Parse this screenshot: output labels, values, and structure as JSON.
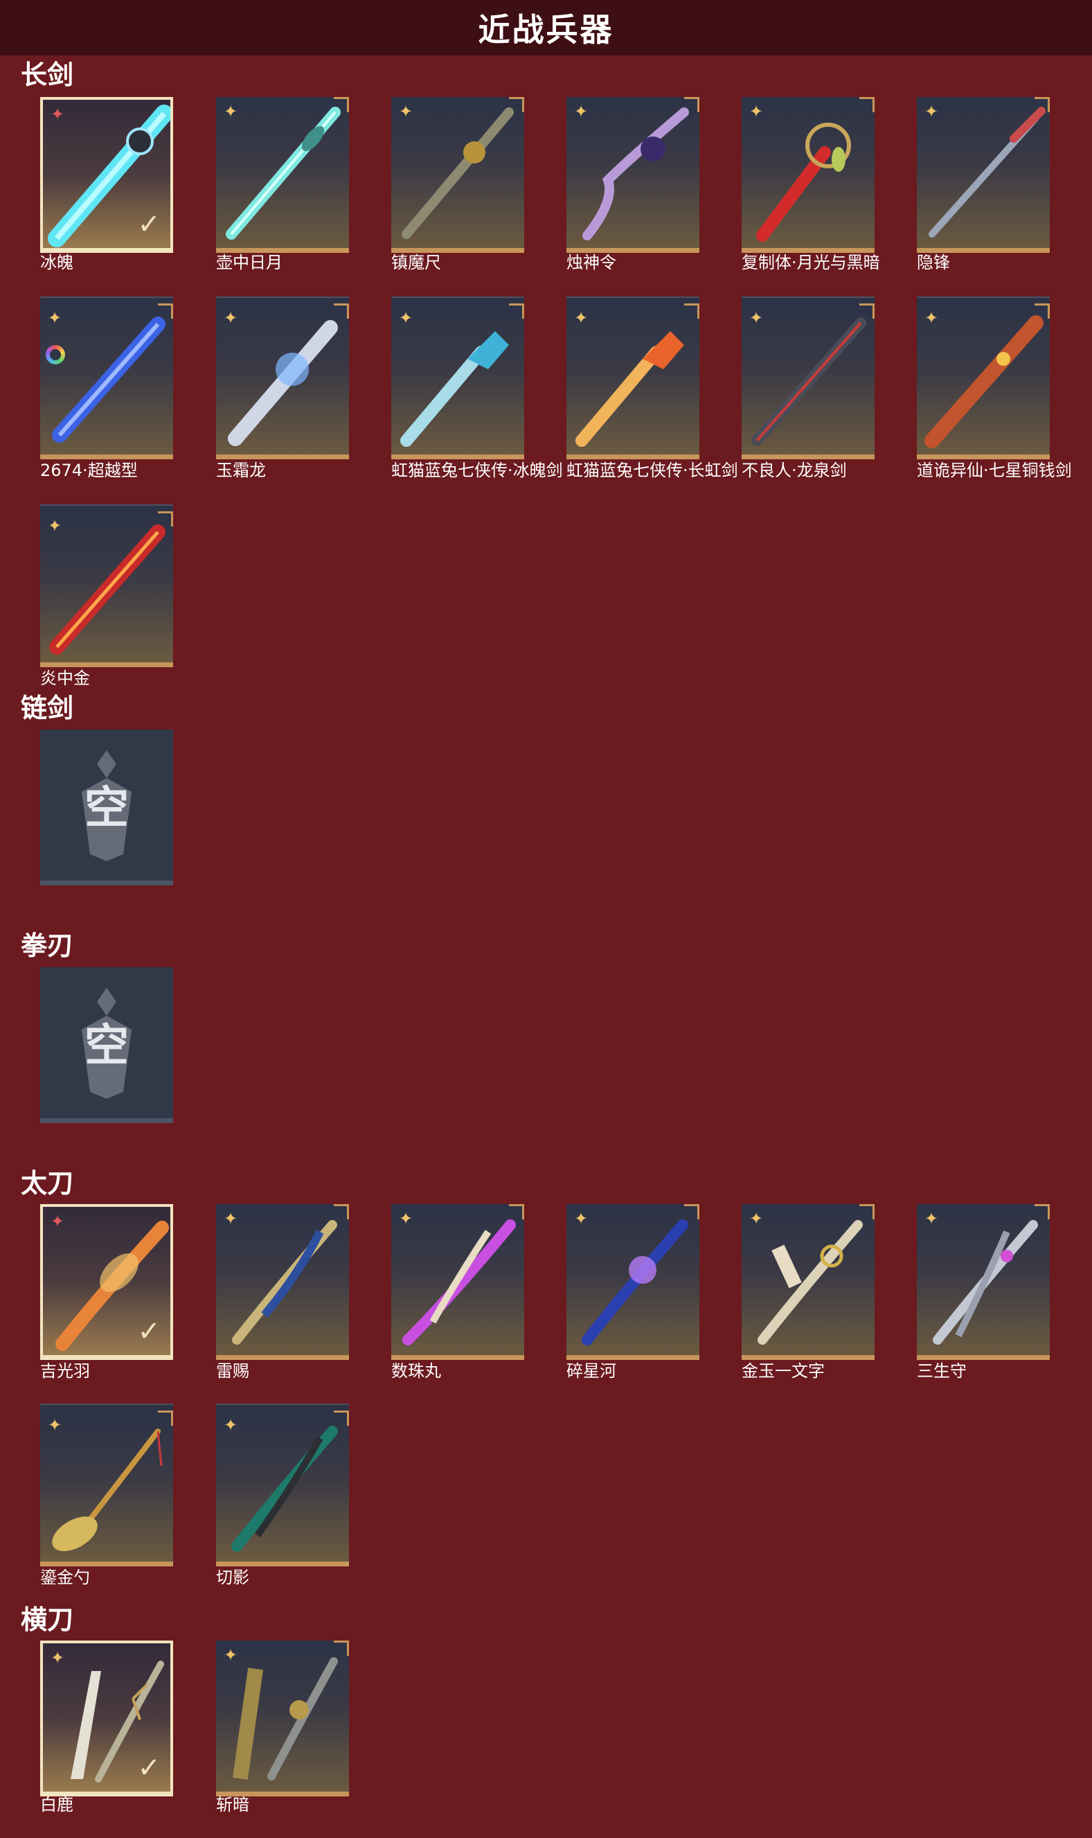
{
  "title": "近战兵器",
  "sections": {
    "changjian": "长剑",
    "lianjian": "链剑",
    "quanren": "拳刃",
    "taidao": "太刀",
    "hengdao": "横刀"
  },
  "empty_label": "空",
  "check_glyph": "✓",
  "rarity_glyph": "✦",
  "weapons": {
    "bingpo": "冰魄",
    "huzhong": "壶中日月",
    "zhenmo": "镇魔尺",
    "zhushen": "烛神令",
    "fuzhiti": "复制体·月光与黑暗",
    "yinfeng": "隐锋",
    "chaoyue": "2674·超越型",
    "yushuang": "玉霜龙",
    "hongmao_bingpo": "虹猫蓝兔七侠传·冰魄剑",
    "hongmao_changhong": "虹猫蓝兔七侠传·长虹剑",
    "buliangren": "不良人·龙泉剑",
    "daogui": "道诡异仙·七星铜钱剑",
    "yanzhongjin": "炎中金",
    "jiguangyu": "吉光羽",
    "leici": "雷赐",
    "shuzhuwan": "数珠丸",
    "suixinghe": "碎星河",
    "jinyu": "金玉一文字",
    "sanshengshou": "三生守",
    "liujinshao": "鎏金勺",
    "qieying": "切影",
    "bailu": "白鹿",
    "zhanan": "斩暗"
  },
  "colors": {
    "background": "#6b1a1f",
    "title_bar": "#3d0e12",
    "card_border": "#c8965a",
    "selected_border": "#f3e4c0",
    "rarity_gold": "#f0c36a",
    "rarity_red": "#e05a5a"
  }
}
